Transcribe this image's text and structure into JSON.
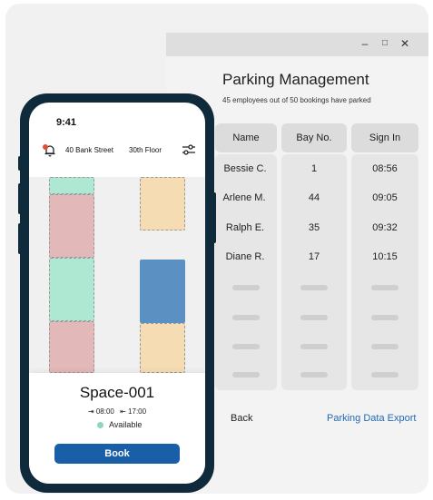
{
  "window": {
    "controls": {
      "minimize": "–",
      "maximize": "□",
      "close": "✕"
    },
    "title": "Parking Management",
    "subtitle": "45 employees out of 50 bookings have parked",
    "columns": [
      "Name",
      "Bay No.",
      "Sign In"
    ],
    "rows": [
      {
        "name": "Bessie C.",
        "bay": "1",
        "sign_in": "08:56"
      },
      {
        "name": "Arlene M.",
        "bay": "44",
        "sign_in": "09:05"
      },
      {
        "name": "Ralph E.",
        "bay": "35",
        "sign_in": "09:32"
      },
      {
        "name": "Diane R.",
        "bay": "17",
        "sign_in": "10:15"
      }
    ],
    "placeholder_rows": 4,
    "back_label": "Back",
    "export_label": "Parking Data Export"
  },
  "phone": {
    "time": "9:41",
    "address": "40 Bank Street",
    "floor": "30th Floor",
    "space_name": "Space-001",
    "time_from": "08:00",
    "time_to": "17:00",
    "status": "Available",
    "book_label": "Book",
    "icons": [
      "bell-icon",
      "filter-icon",
      "sign-in-icon",
      "sign-out-icon"
    ]
  },
  "colors": {
    "accent": "#195fa7",
    "link": "#2369b4",
    "available": "#aee8d3",
    "occupied": "#e2b8b8",
    "reserved": "#f6dcb3",
    "selected": "#5b90c2",
    "phone_frame": "#0f2a3a"
  }
}
